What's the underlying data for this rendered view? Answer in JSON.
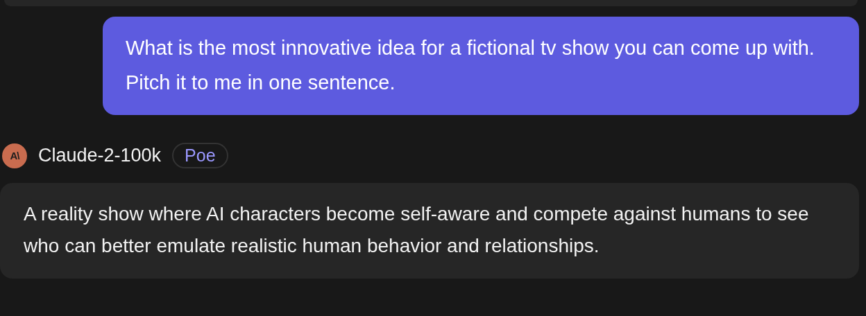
{
  "user_message": {
    "text": "What is the most innovative idea for a fictional tv show you can come up with. Pitch it to me in one sentence."
  },
  "bot": {
    "avatar_mark": "A\\",
    "name": "Claude-2-100k",
    "badge": "Poe"
  },
  "bot_message": {
    "text": "A reality show where AI characters become self-aware and compete against humans to see who can better emulate realistic human behavior and relationships."
  }
}
